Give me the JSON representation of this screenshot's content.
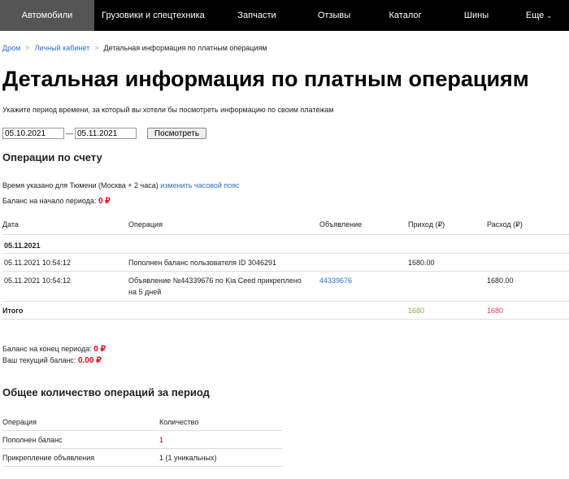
{
  "nav": {
    "items": [
      "Автомобили",
      "Грузовики и спецтехника",
      "Запчасти",
      "Отзывы",
      "Каталог",
      "Шины",
      "Еще"
    ],
    "more_icon": "chevron-down-icon"
  },
  "breadcrumb": {
    "items": [
      "Дром",
      "Личный кабинет",
      "Детальная информация по платным операциям"
    ],
    "sep": ">"
  },
  "title": "Детальная информация по платным операциям",
  "hint": "Укажите период времени, за который вы хотели бы посмотреть информацию по своим платежам",
  "form": {
    "from": "05.10.2021",
    "dash": "—",
    "to": "05.11.2021",
    "submit": "Посмотреть"
  },
  "ops": {
    "heading": "Операции по счету",
    "tz_text": "Время указано для Тюмени (Москва + 2 часа)",
    "tz_link": "изменить часовой пояс",
    "start_label": "Баланс на начало периода:",
    "start_value": "0 ₽",
    "headers": [
      "Дата",
      "Операция",
      "Объявление",
      "Приход (₽)",
      "Расход (₽)"
    ],
    "group_date": "05.11.2021",
    "rows": [
      {
        "date": "05.11.2021 10:54:12",
        "op": "Пополнен баланс пользователя ID 3046291",
        "ad": "",
        "in": "1680.00",
        "out": ""
      },
      {
        "date": "05.11.2021 10:54:12",
        "op": "Объявление №44339676 по Kia Ceed прикреплено на 5 дней",
        "ad": "44339676",
        "in": "",
        "out": "1680.00"
      }
    ],
    "total_label": "Итого",
    "total_in": "1680",
    "total_out": "1680",
    "end_label": "Баланс на конец периода:",
    "end_value": "0 ₽",
    "cur_label": "Ваш текущий баланс:",
    "cur_value": "0.00 ₽"
  },
  "summary": {
    "heading": "Общее количество операций за период",
    "headers": [
      "Операция",
      "Количество"
    ],
    "rows": [
      {
        "op": "Пополнен баланс",
        "count": "1"
      },
      {
        "op": "Прикрепление объявления",
        "count": "1 (1 уникальных)"
      }
    ]
  }
}
